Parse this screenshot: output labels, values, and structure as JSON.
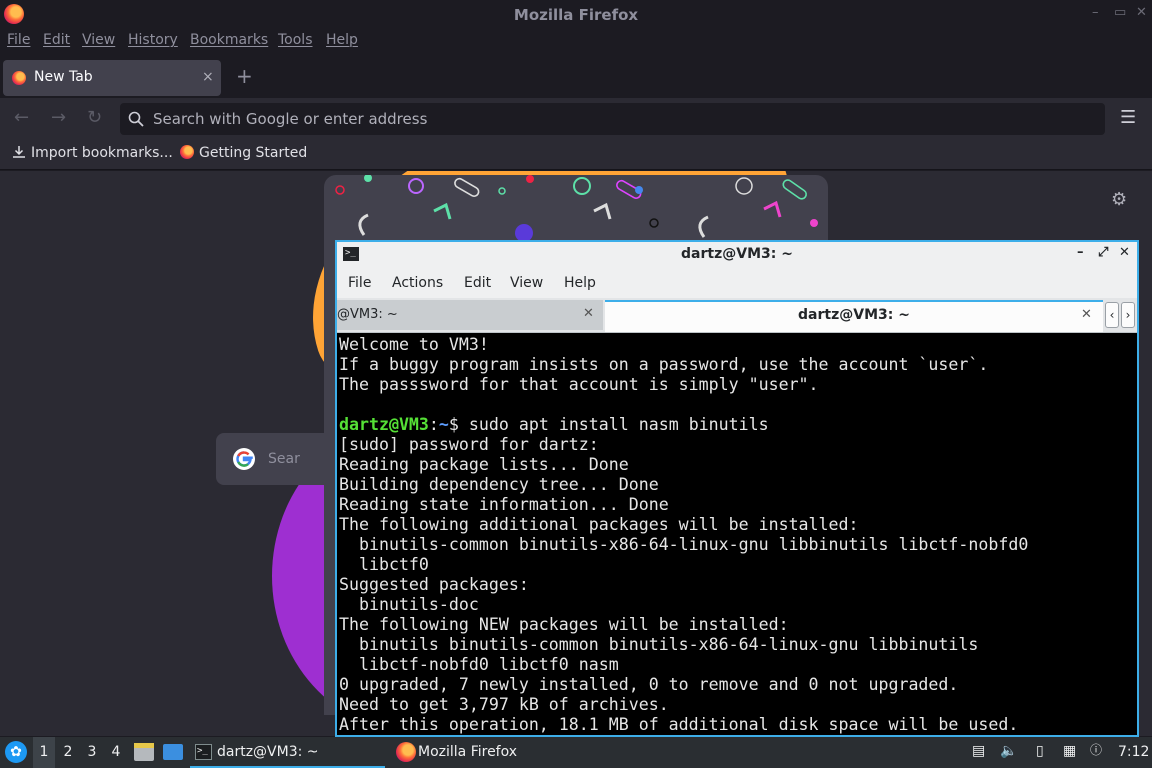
{
  "firefox": {
    "window_title": "Mozilla Firefox",
    "menu": [
      "File",
      "Edit",
      "View",
      "History",
      "Bookmarks",
      "Tools",
      "Help"
    ],
    "tab": {
      "label": "New Tab",
      "close": "×"
    },
    "new_tab_symbol": "+",
    "url_placeholder": "Search with Google or enter address",
    "bookmarks": [
      "Import bookmarks...",
      "Getting Started"
    ],
    "search_box_text": "Sear",
    "accent_colors": {
      "orange": "#ffa436",
      "purple": "#9e2fd1"
    }
  },
  "terminal": {
    "window_title": "dartz@VM3: ~",
    "menu": [
      "File",
      "Actions",
      "Edit",
      "View",
      "Help"
    ],
    "tabs": [
      {
        "label": "@VM3: ~",
        "active": false
      },
      {
        "label": "dartz@VM3: ~",
        "active": true
      }
    ],
    "prompt": {
      "user_host": "dartz@VM3",
      "sep": ":",
      "path": "~",
      "symbol": "$",
      "command": " sudo apt install nasm binutils"
    },
    "lines_before": [
      "Welcome to VM3!",
      "If a buggy program insists on a password, use the account `user`.",
      "The passsword for that account is simply \"user\".",
      ""
    ],
    "lines_after": [
      "[sudo] password for dartz:",
      "Reading package lists... Done",
      "Building dependency tree... Done",
      "Reading state information... Done",
      "The following additional packages will be installed:",
      "  binutils-common binutils-x86-64-linux-gnu libbinutils libctf-nobfd0",
      "  libctf0",
      "Suggested packages:",
      "  binutils-doc",
      "The following NEW packages will be installed:",
      "  binutils binutils-common binutils-x86-64-linux-gnu libbinutils",
      "  libctf-nobfd0 libctf0 nasm",
      "0 upgraded, 7 newly installed, 0 to remove and 0 not upgraded.",
      "Need to get 3,797 kB of archives.",
      "After this operation, 18.1 MB of additional disk space will be used."
    ],
    "colors": {
      "user": "#55e036",
      "path": "#5d9dff",
      "border": "#3daee9"
    }
  },
  "taskbar": {
    "desktops": [
      "1",
      "2",
      "3",
      "4"
    ],
    "active_desktop": "1",
    "tasks": [
      "dartz@VM3: ~",
      "Mozilla Firefox"
    ],
    "clock": "7:12",
    "icons": [
      "start-menu-icon",
      "file-manager-icon",
      "show-desktop-icon",
      "clipboard-icon",
      "volume-icon",
      "notes-icon",
      "network-icon",
      "notification-icon"
    ]
  }
}
